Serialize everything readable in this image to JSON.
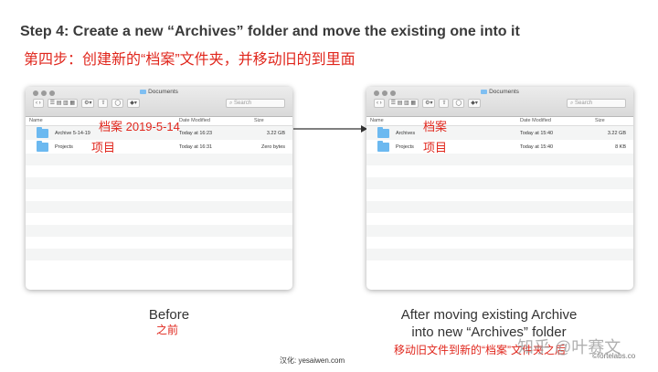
{
  "heading": {
    "en": "Step 4: Create a new “Archives” folder and move the existing one into it",
    "cn": "第四步：创建新的“档案”文件夹，并移动旧的到里面"
  },
  "finder": {
    "window_title": "Documents",
    "search_placeholder": "Search",
    "columns": {
      "name": "Name",
      "date": "Date Modified",
      "size": "Size"
    }
  },
  "before": {
    "rows": [
      {
        "name": "Archive 5-14-19",
        "date": "Today at 16:23",
        "size": "3.22 GB"
      },
      {
        "name": "Projects",
        "date": "Today at 16:31",
        "size": "Zero bytes"
      }
    ],
    "note_archive": "档案 2019-5-14",
    "note_projects": "项目",
    "caption": "Before",
    "caption_cn": "之前"
  },
  "after": {
    "rows": [
      {
        "name": "Archives",
        "date": "Today at 15:40",
        "size": "3.22 GB"
      },
      {
        "name": "Projects",
        "date": "Today at 15:40",
        "size": "8 KB"
      }
    ],
    "note_archives": "档案",
    "note_projects": "项目",
    "caption_line1": "After moving existing Archive",
    "caption_line2": "into new “Archives” folder",
    "caption_cn": "移动旧文件到新的“档案”文件夹之后"
  },
  "footer": "汉化: yesaiwen.com",
  "watermark": "知乎 @叶赛文",
  "credit": "©fortelabs.co",
  "colors": {
    "accent_red": "#e0261c",
    "folder_blue": "#6cb9f0"
  }
}
